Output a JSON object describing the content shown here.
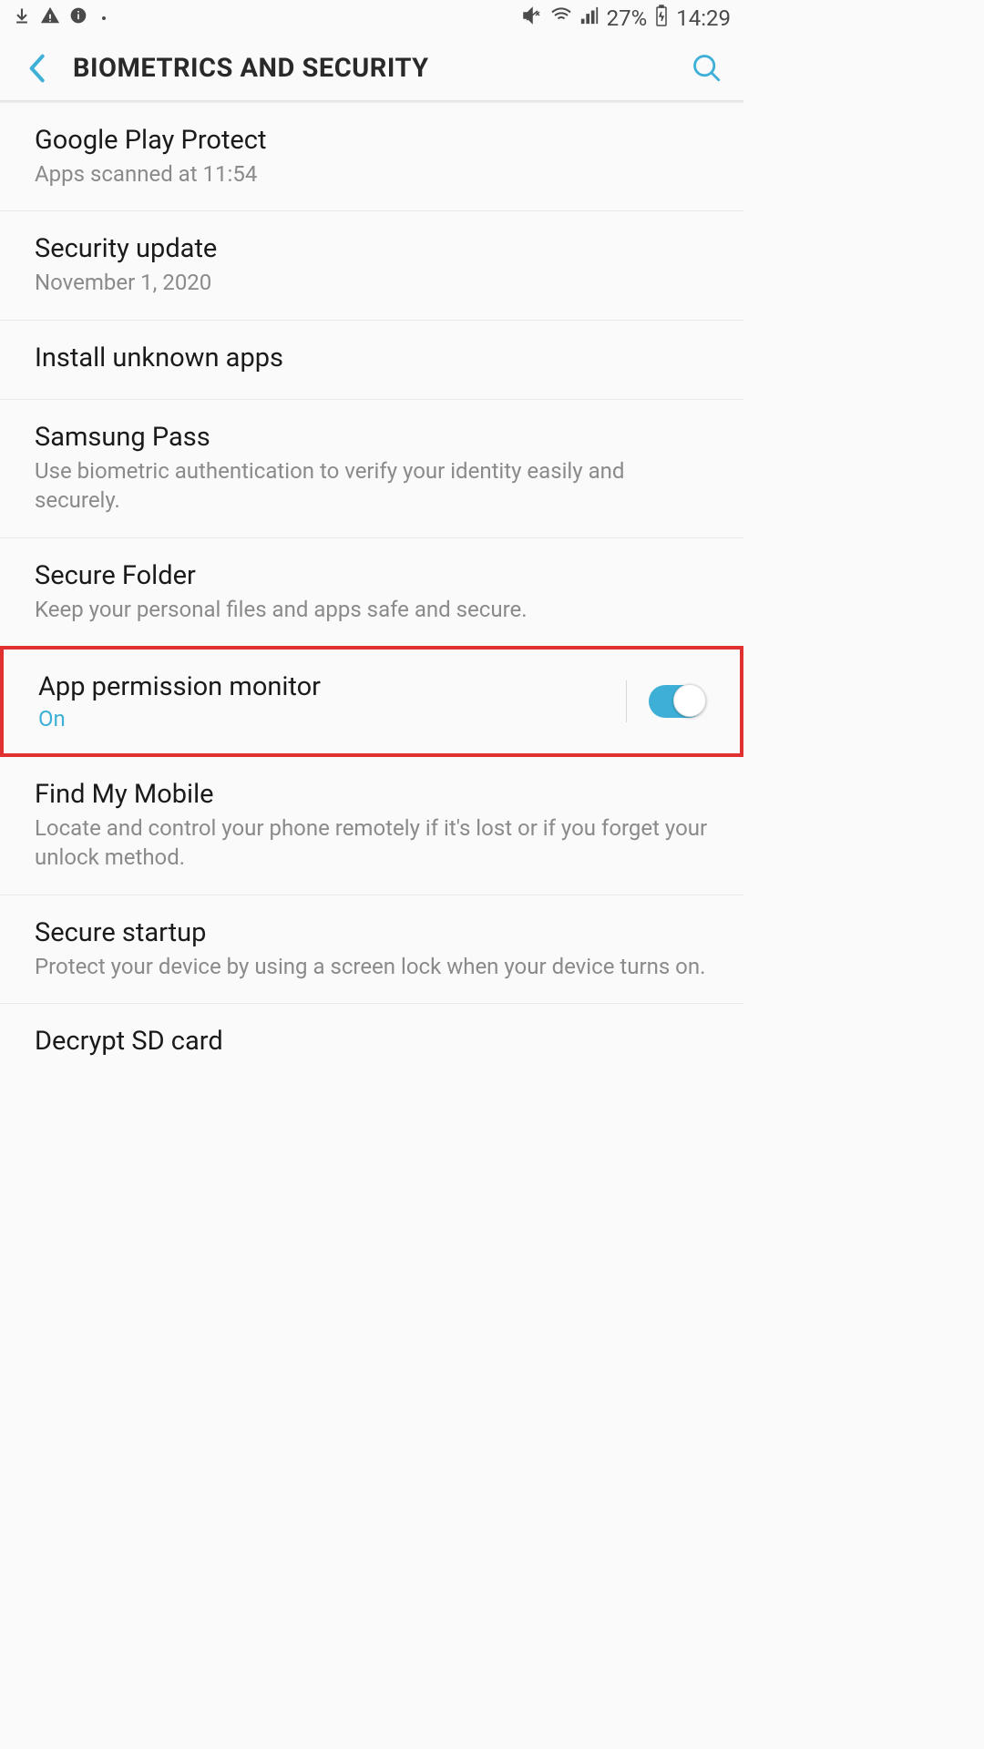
{
  "status_bar": {
    "battery_percent": "27%",
    "time": "14:29"
  },
  "header": {
    "title": "BIOMETRICS AND SECURITY"
  },
  "items": [
    {
      "title": "Google Play Protect",
      "subtitle": "Apps scanned at 11:54"
    },
    {
      "title": "Security update",
      "subtitle": "November 1, 2020"
    },
    {
      "title": "Install unknown apps",
      "subtitle": ""
    },
    {
      "title": "Samsung Pass",
      "subtitle": "Use biometric authentication to verify your identity easily and securely."
    },
    {
      "title": "Secure Folder",
      "subtitle": "Keep your personal files and apps safe and secure."
    },
    {
      "title": "App permission monitor",
      "subtitle_accent": "On"
    },
    {
      "title": "Find My Mobile",
      "subtitle": "Locate and control your phone remotely if it's lost or if you forget your unlock method."
    },
    {
      "title": "Secure startup",
      "subtitle": "Protect your device by using a screen lock when your device turns on."
    },
    {
      "title": "Decrypt SD card",
      "subtitle": ""
    }
  ]
}
